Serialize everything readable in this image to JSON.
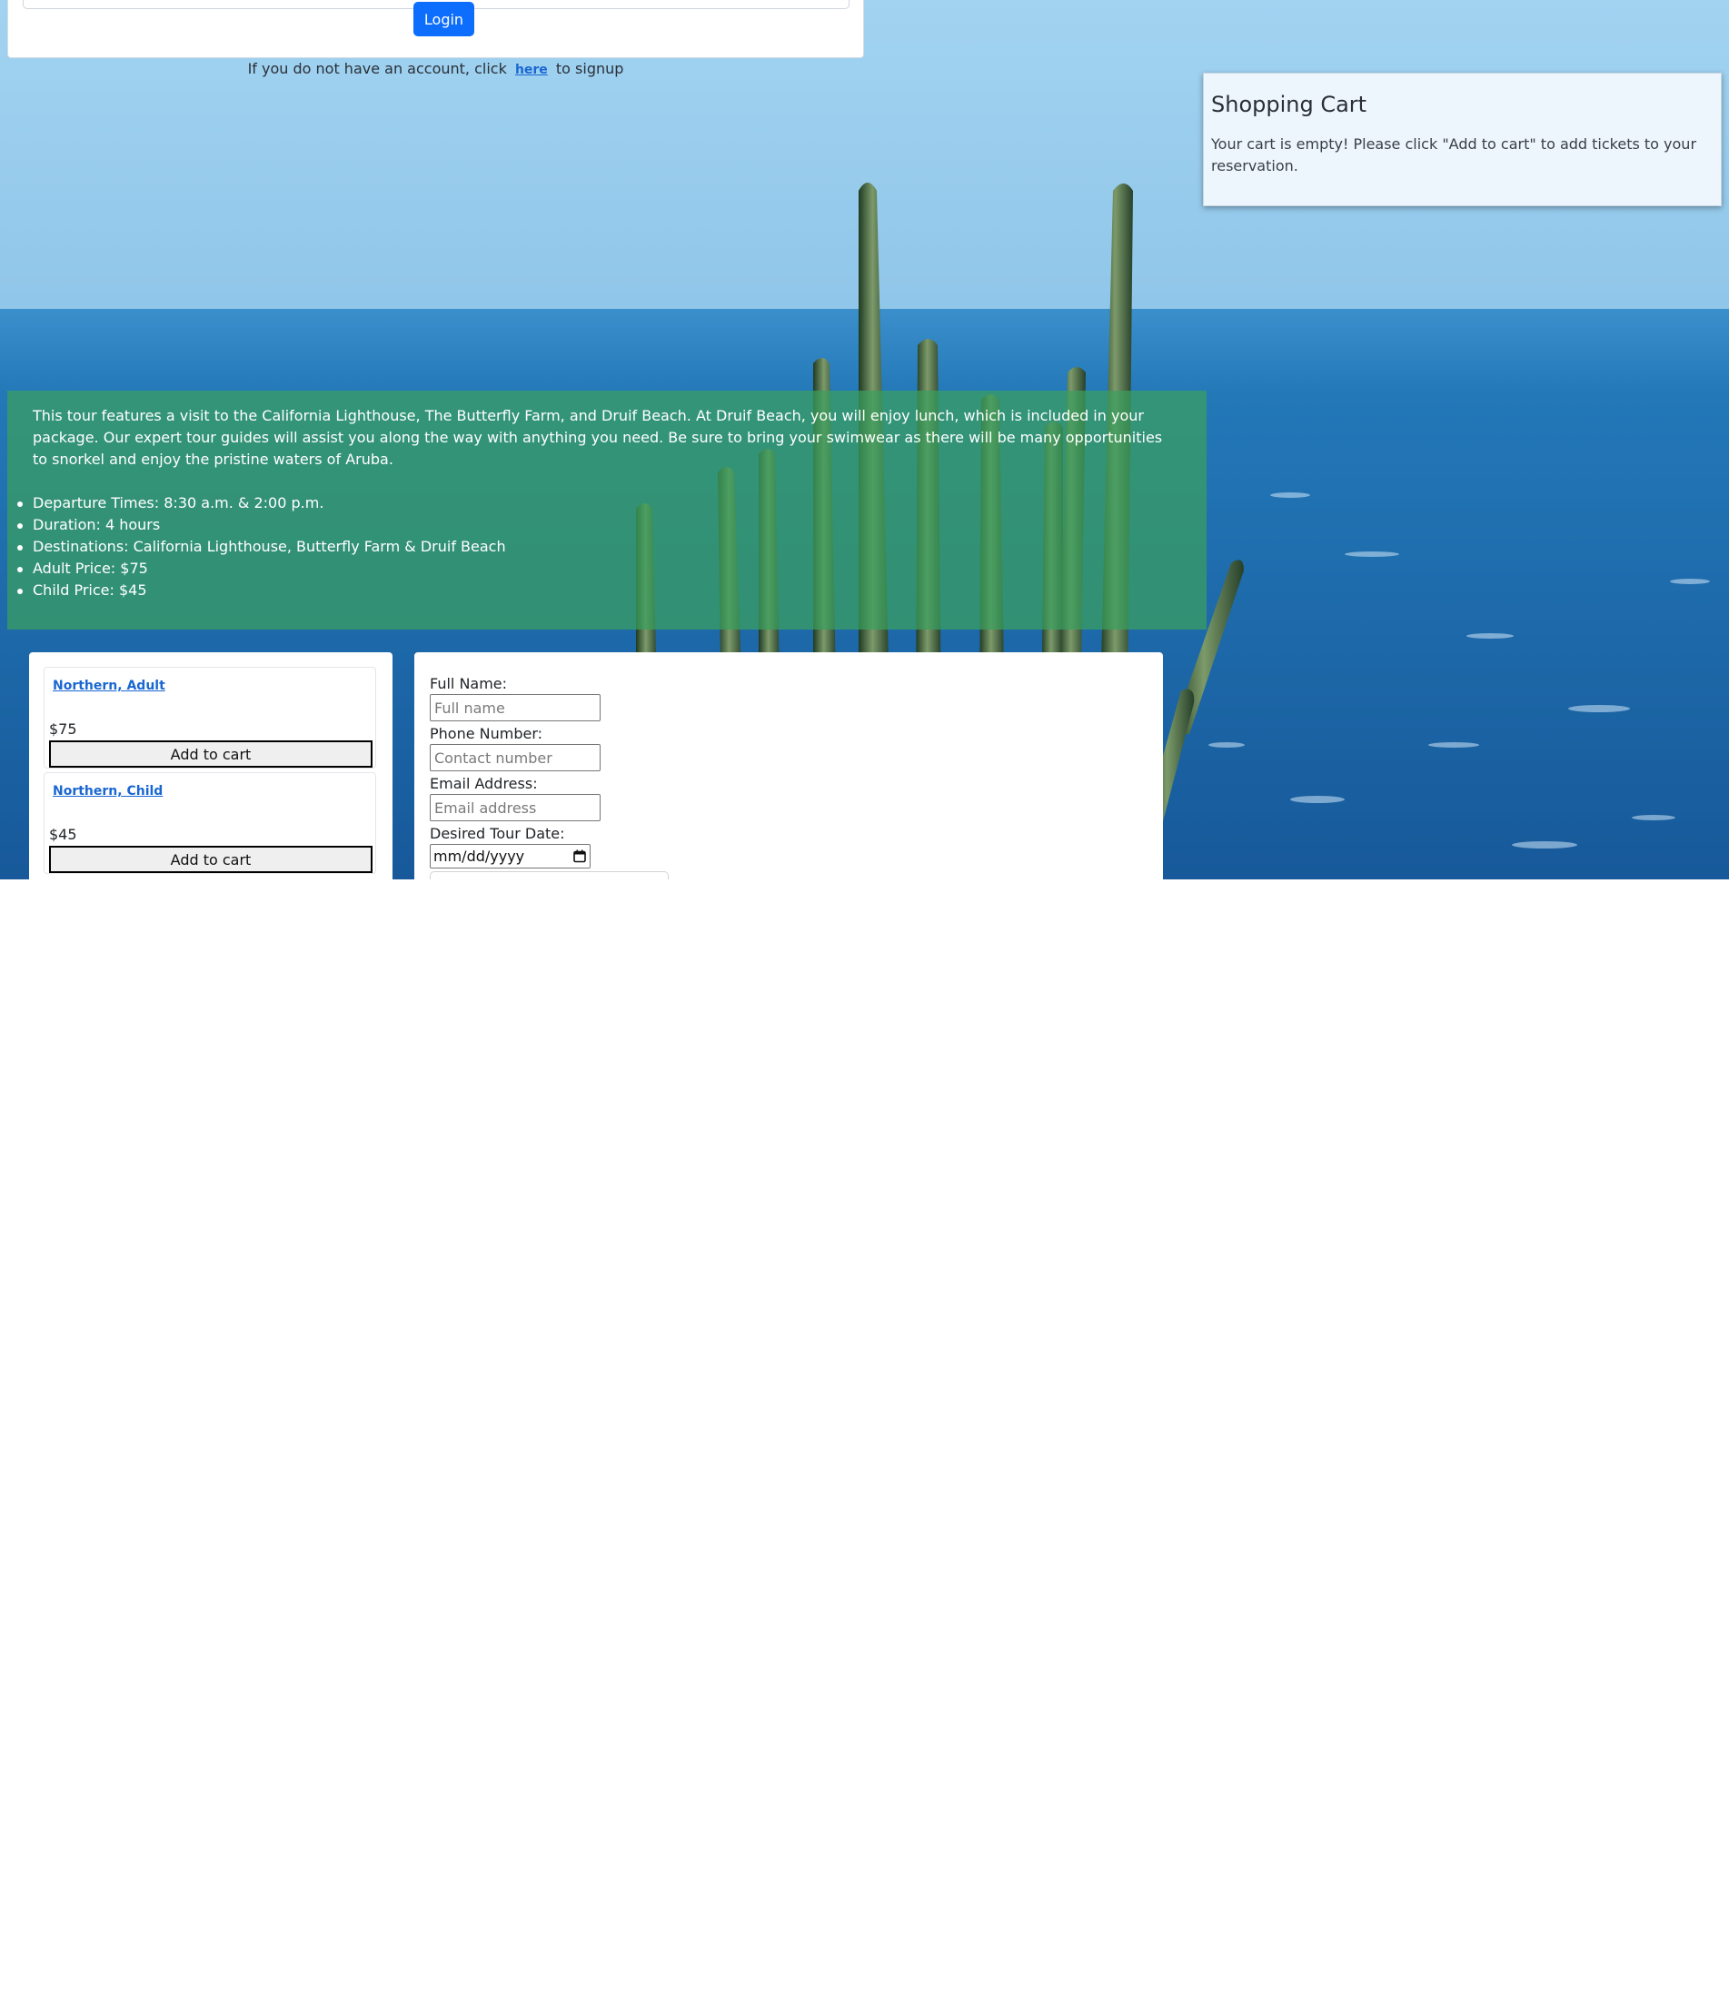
{
  "login": {
    "button_label": "Login",
    "signup_prefix": "If you do not have an account, click",
    "signup_link": "here",
    "signup_suffix": "to signup"
  },
  "cart": {
    "title": "Shopping Cart",
    "empty_message": "Your cart is empty! Please click \"Add to cart\" to add tickets to your reservation."
  },
  "tour": {
    "description": "This tour features a visit to the California Lighthouse, The Butterfly Farm, and Druif Beach. At Druif Beach, you will enjoy lunch, which is included in your package. Our expert tour guides will assist you along the way with anything you need. Be sure to bring your swimwear as there will be many opportunities to snorkel and enjoy the pristine waters of Aruba.",
    "details": [
      "Departure Times: 8:30 a.m. & 2:00 p.m.",
      "Duration: 4 hours",
      "Destinations: California Lighthouse, Butterfly Farm & Druif Beach",
      "Adult Price: $75",
      "Child Price: $45"
    ]
  },
  "products": [
    {
      "name": "Northern, Adult",
      "price": "$75",
      "button_label": "Add to cart"
    },
    {
      "name": "Northern, Child",
      "price": "$45",
      "button_label": "Add to cart"
    }
  ],
  "form": {
    "full_name_label": "Full Name:",
    "full_name_placeholder": "Full name",
    "phone_label": "Phone Number:",
    "phone_placeholder": "Contact number",
    "email_label": "Email Address:",
    "email_placeholder": "Email address",
    "date_label": "Desired Tour Date:",
    "date_value": "mm/dd/yyyy"
  },
  "colors": {
    "primary_button": "#0d6efd",
    "link": "#1a67d2",
    "description_overlay": "#3aa05e"
  },
  "icons": [
    "calendar-icon"
  ]
}
